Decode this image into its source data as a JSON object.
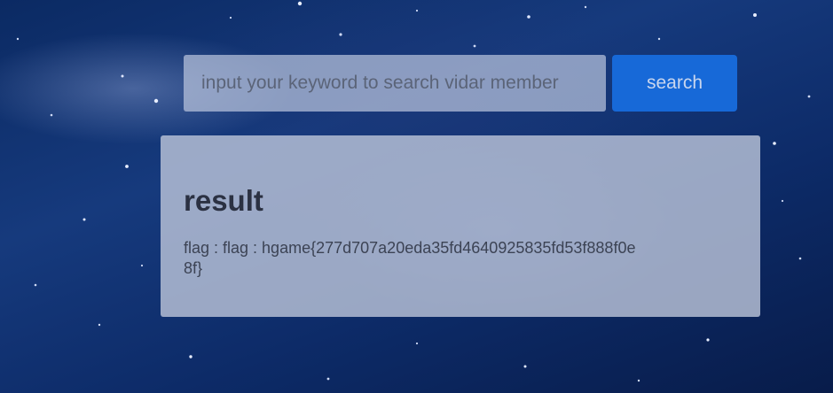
{
  "search": {
    "placeholder": "input your keyword to search vidar member",
    "button_label": "search"
  },
  "result": {
    "title": "result",
    "text": "flag : flag : hgame{277d707a20eda35fd4640925835fd53f888f0e8f}"
  },
  "colors": {
    "background": "#123574",
    "button": "#1769d8",
    "panel": "#bec7db",
    "title_text": "#2b3142"
  }
}
